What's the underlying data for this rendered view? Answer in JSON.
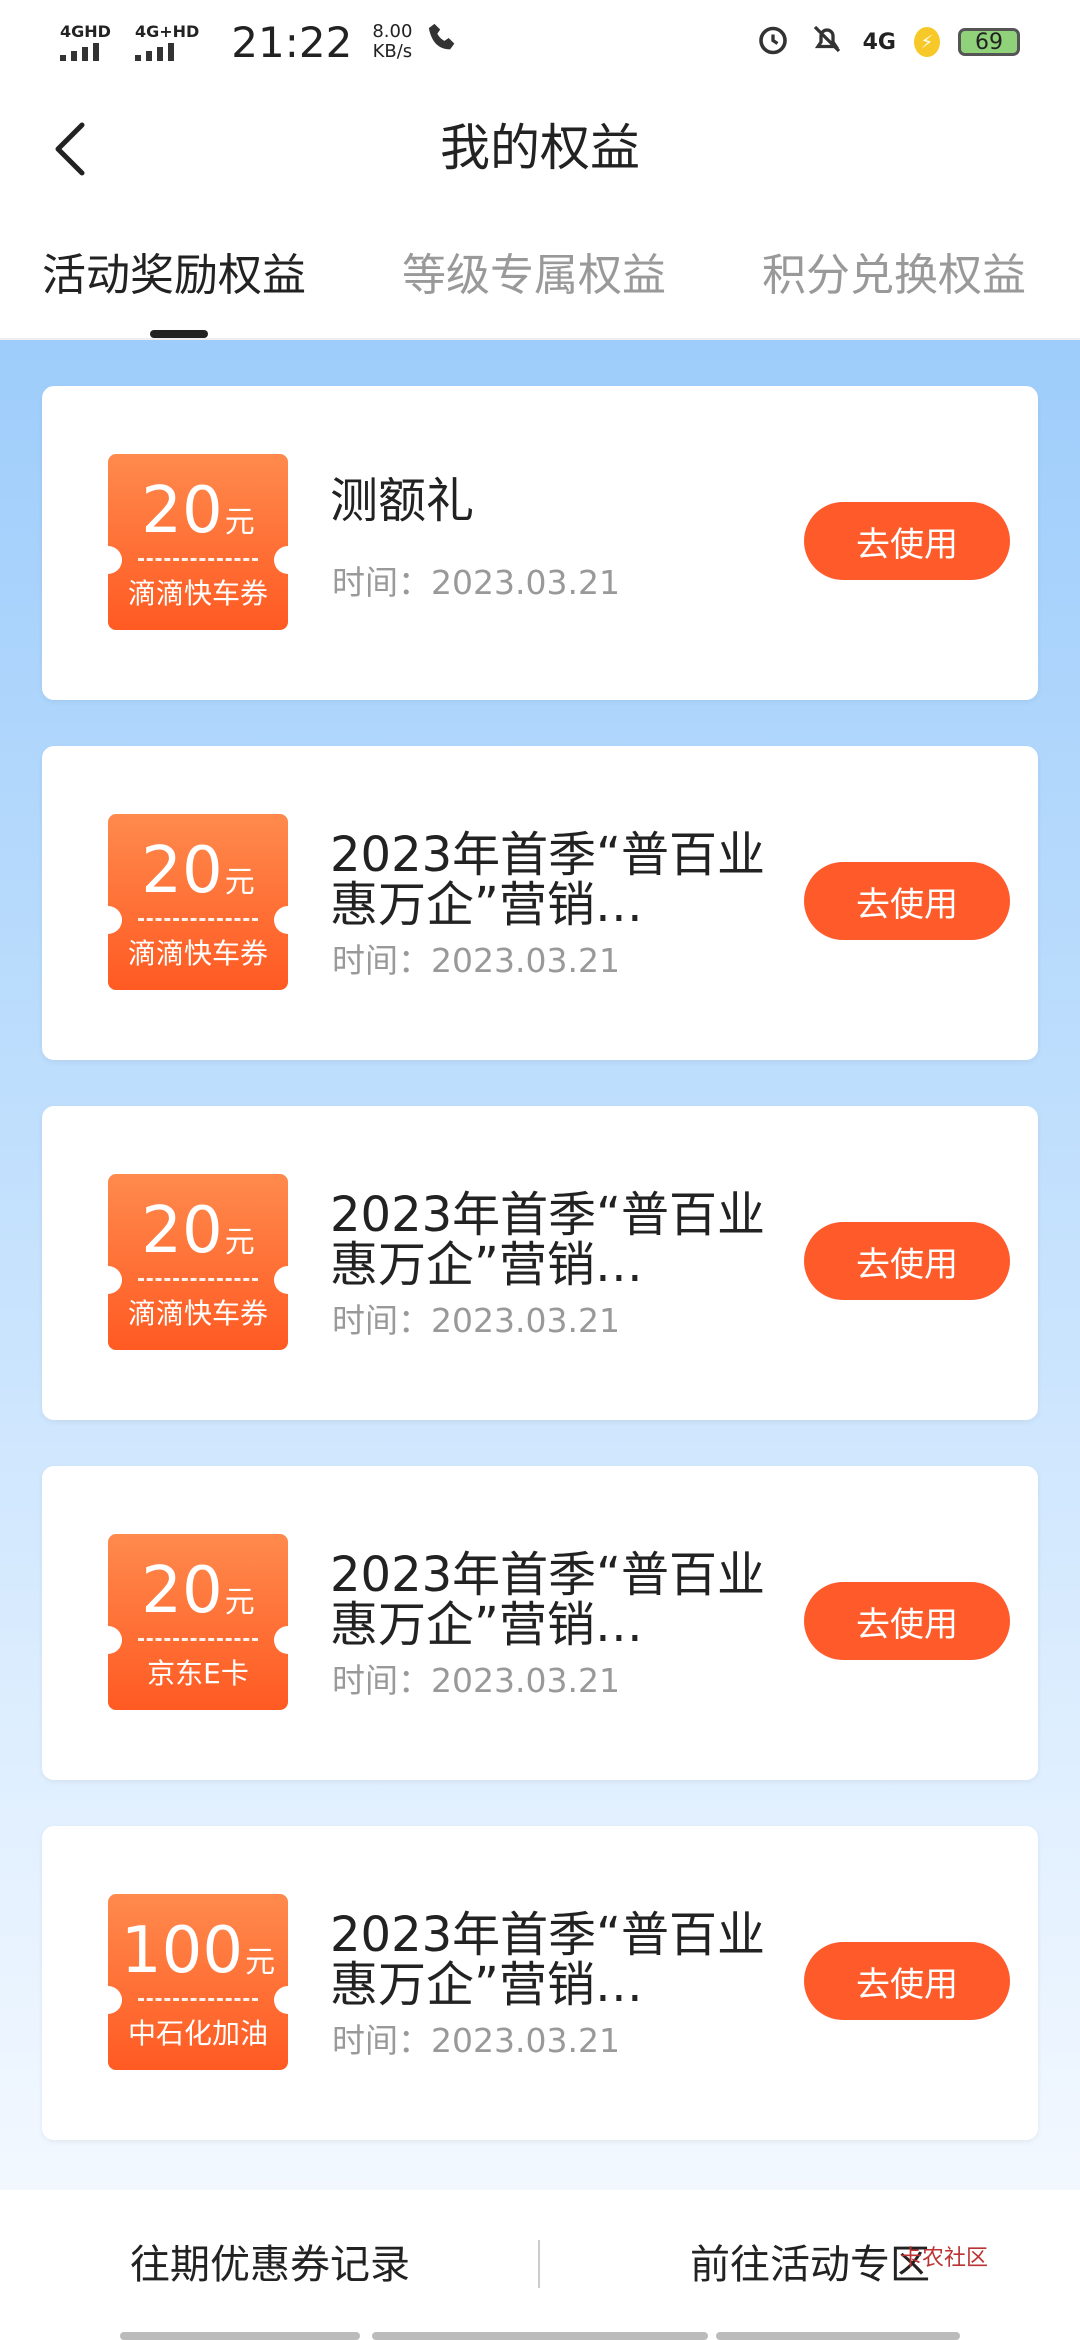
{
  "status_bar": {
    "network1": "4GHD",
    "network2": "4G+HD",
    "time": "21:22",
    "speed_value": "8.00",
    "speed_unit": "KB/s",
    "network3": "4G",
    "battery": "69"
  },
  "nav": {
    "title": "我的权益"
  },
  "tabs": [
    {
      "label": "活动奖励权益",
      "active": true
    },
    {
      "label": "等级专属权益",
      "active": false
    },
    {
      "label": "积分兑换权益",
      "active": false
    }
  ],
  "cards": [
    {
      "amount": "20",
      "unit": "元",
      "coupon_name": "滴滴快车券",
      "title": "测额礼",
      "time": "时间：2023.03.21",
      "button": "去使用"
    },
    {
      "amount": "20",
      "unit": "元",
      "coupon_name": "滴滴快车券",
      "title": "2023年首季“普百业 惠万企”营销…",
      "time": "时间：2023.03.21",
      "button": "去使用"
    },
    {
      "amount": "20",
      "unit": "元",
      "coupon_name": "滴滴快车券",
      "title": "2023年首季“普百业 惠万企”营销…",
      "time": "时间：2023.03.21",
      "button": "去使用"
    },
    {
      "amount": "20",
      "unit": "元",
      "coupon_name": "京东E卡",
      "title": "2023年首季“普百业 惠万企”营销…",
      "time": "时间：2023.03.21",
      "button": "去使用"
    },
    {
      "amount": "100",
      "unit": "元",
      "coupon_name": "中石化加油",
      "title": "2023年首季“普百业 惠万企”营销…",
      "time": "时间：2023.03.21",
      "button": "去使用"
    }
  ],
  "bottom": {
    "left_link": "往期优惠券记录",
    "right_link": "前往活动专区",
    "watermark": "卡农社区"
  },
  "colors": {
    "accent": "#ff5a2a",
    "bg_top": "#9ecdfb"
  }
}
